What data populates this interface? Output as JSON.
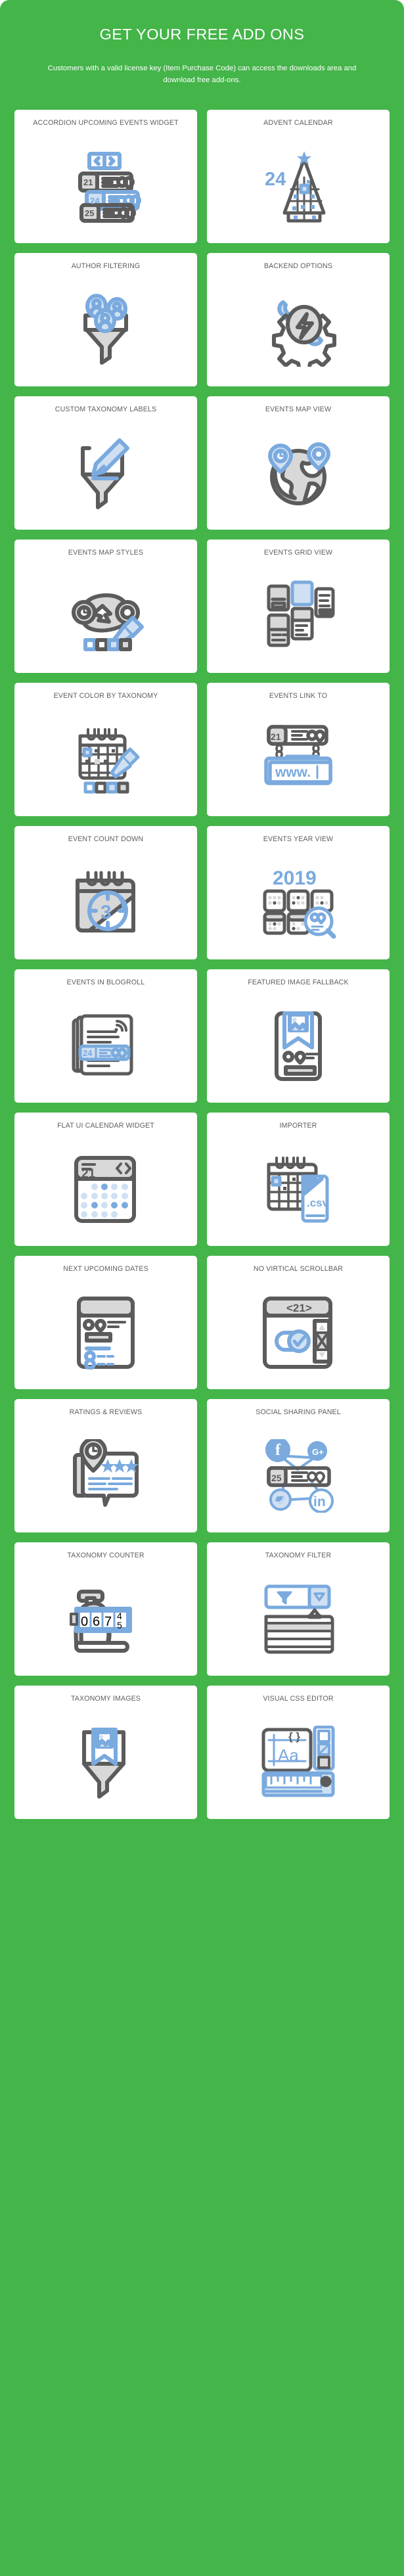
{
  "header": {
    "title": "GET YOUR FREE ADD ONS",
    "subtitle": "Customers with a valid license key (Item Purchase Code) can access the downloads area and download free add-ons."
  },
  "theme": {
    "background": "#44b549",
    "card_background": "#ffffff",
    "title_color": "#ffffff",
    "card_title_color": "#5e5e5e",
    "icon_dark": "#5b5b5b",
    "icon_blue": "#7aaade",
    "icon_grey_fill": "#d8d8d8",
    "icon_blue_fill": "#cfe0f3"
  },
  "cards": [
    {
      "title": "ACCORDION UPCOMING EVENTS WIDGET",
      "icon": "accordion-events-icon",
      "labels": [
        "21",
        "24",
        "25"
      ]
    },
    {
      "title": "ADVENT CALENDAR",
      "icon": "advent-calendar-icon",
      "labels": [
        "24"
      ]
    },
    {
      "title": "AUTHOR FILTERING",
      "icon": "author-filter-funnel-icon",
      "labels": []
    },
    {
      "title": "BACKEND OPTIONS",
      "icon": "gear-wrench-bolt-icon",
      "labels": []
    },
    {
      "title": "CUSTOM TAXONOMY LABELS",
      "icon": "funnel-pencil-icon",
      "labels": []
    },
    {
      "title": "EVENTS MAP VIEW",
      "icon": "globe-pins-icon",
      "labels": []
    },
    {
      "title": "EVENTS MAP STYLES",
      "icon": "map-paint-swatches-icon",
      "labels": []
    },
    {
      "title": "EVENTS GRID VIEW",
      "icon": "grid-cards-icon",
      "labels": []
    },
    {
      "title": "EVENT COLOR BY TAXONOMY",
      "icon": "calendar-paint-swatches-icon",
      "labels": []
    },
    {
      "title": "EVENTS LINK TO",
      "icon": "hanging-url-sign-icon",
      "labels": [
        "21",
        "www."
      ]
    },
    {
      "title": "EVENT COUNT DOWN",
      "icon": "calendar-countdown-icon",
      "labels": [
        "3"
      ]
    },
    {
      "title": "EVENTS YEAR VIEW",
      "icon": "year-months-magnifier-icon",
      "labels": [
        "2019"
      ]
    },
    {
      "title": "EVENTS IN BLOGROLL",
      "icon": "newspaper-rss-icon",
      "labels": [
        "24"
      ]
    },
    {
      "title": "FEATURED IMAGE FALLBACK",
      "icon": "phone-bookmark-image-icon",
      "labels": []
    },
    {
      "title": "FLAT UI CALENDAR WIDGET",
      "icon": "flat-calendar-dots-icon",
      "labels": [
        "21"
      ]
    },
    {
      "title": "IMPORTER",
      "icon": "calendar-csv-import-icon",
      "labels": [
        ".csv"
      ]
    },
    {
      "title": "NEXT UPCOMING DATES",
      "icon": "upcoming-dates-list-icon",
      "labels": []
    },
    {
      "title": "NO VIRTICAL SCROLLBAR",
      "icon": "no-scrollbar-toggle-icon",
      "labels": [
        "21"
      ]
    },
    {
      "title": "RATINGS & REVIEWS",
      "icon": "review-bubble-stars-icon",
      "labels": []
    },
    {
      "title": "SOCIAL SHARING PANEL",
      "icon": "social-share-network-icon",
      "labels": [
        "25"
      ]
    },
    {
      "title": "TAXONOMY COUNTER",
      "icon": "mechanical-counter-icon",
      "labels": [
        "0",
        "6",
        "7",
        "4",
        "5"
      ]
    },
    {
      "title": "TAXONOMY FILTER",
      "icon": "filter-dropdown-icon",
      "labels": []
    },
    {
      "title": "TAXONOMY IMAGES",
      "icon": "funnel-image-bookmark-icon",
      "labels": []
    },
    {
      "title": "VISUAL CSS EDITOR",
      "icon": "css-editor-ruler-icon",
      "labels": [
        "Aa",
        "{ }"
      ]
    }
  ]
}
